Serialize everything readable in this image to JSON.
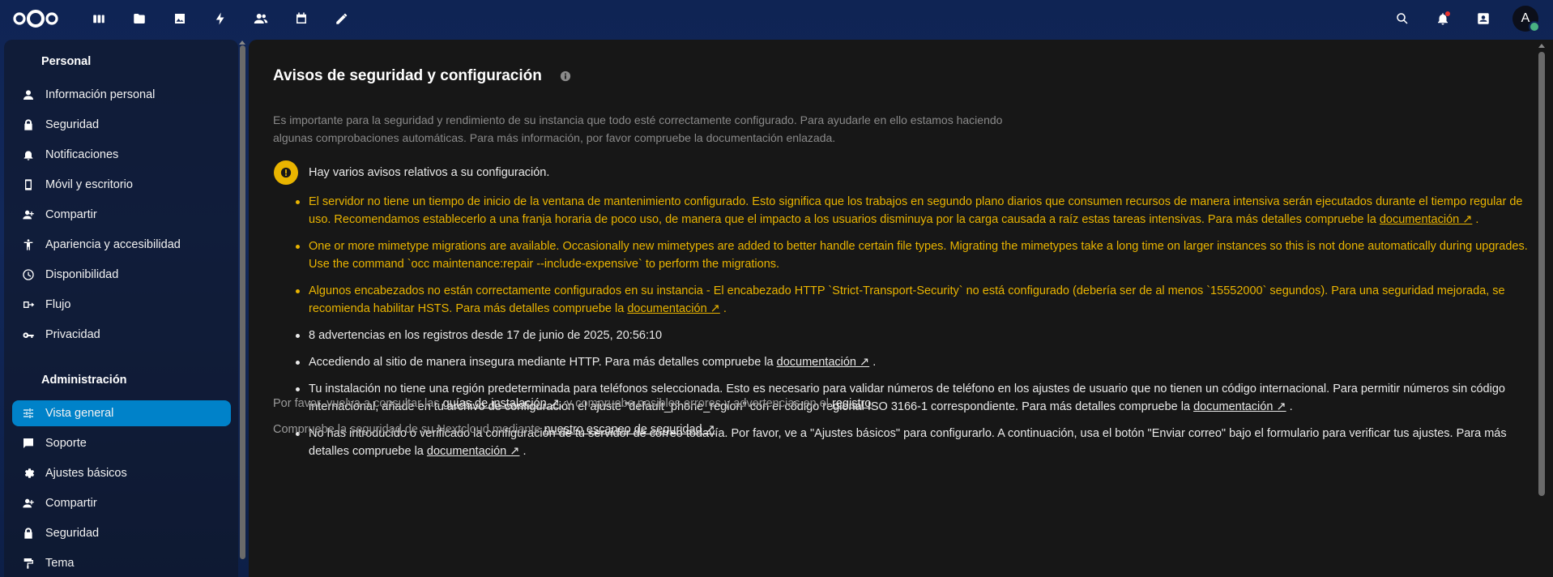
{
  "header": {
    "apps": [
      {
        "name": "dashboard-icon"
      },
      {
        "name": "files-icon"
      },
      {
        "name": "photos-icon"
      },
      {
        "name": "activity-icon"
      },
      {
        "name": "contacts-icon"
      },
      {
        "name": "calendar-icon"
      },
      {
        "name": "notes-icon"
      }
    ],
    "avatar_letter": "A"
  },
  "sidebar": {
    "personal_heading": "Personal",
    "personal_items": [
      {
        "label": "Información personal",
        "icon": "user-icon"
      },
      {
        "label": "Seguridad",
        "icon": "lock-icon"
      },
      {
        "label": "Notificaciones",
        "icon": "bell-icon"
      },
      {
        "label": "Móvil y escritorio",
        "icon": "phone-icon"
      },
      {
        "label": "Compartir",
        "icon": "share-icon"
      },
      {
        "label": "Apariencia y accesibilidad",
        "icon": "accessibility-icon"
      },
      {
        "label": "Disponibilidad",
        "icon": "clock-icon"
      },
      {
        "label": "Flujo",
        "icon": "flow-icon"
      },
      {
        "label": "Privacidad",
        "icon": "key-icon"
      }
    ],
    "admin_heading": "Administración",
    "admin_items": [
      {
        "label": "Vista general",
        "icon": "sliders-icon",
        "active": true
      },
      {
        "label": "Soporte",
        "icon": "chat-icon"
      },
      {
        "label": "Ajustes básicos",
        "icon": "gear-icon"
      },
      {
        "label": "Compartir",
        "icon": "share-icon"
      },
      {
        "label": "Seguridad",
        "icon": "lock-icon"
      },
      {
        "label": "Tema",
        "icon": "paint-icon"
      }
    ]
  },
  "main": {
    "title": "Avisos de seguridad y configuración",
    "intro": "Es importante para la seguridad y rendimiento de su instancia que todo esté correctamente configurado. Para ayudarle en ello estamos haciendo algunas comprobaciones automáticas. Para más información, por favor compruebe la documentación enlazada.",
    "warning_heading": "Hay varios avisos relativos a su configuración.",
    "link_doc": "documentación ↗",
    "issues": {
      "i1_text": "El servidor no tiene un tiempo de inicio de la ventana de mantenimiento configurado. Esto significa que los trabajos en segundo plano diarios que consumen recursos de manera intensiva serán ejecutados durante el tiempo regular de uso. Recomendamos establecerlo a una franja horaria de poco uso, de manera que el impacto a los usuarios disminuya por la carga causada a raíz estas tareas intensivas. Para más detalles compruebe la",
      "i2_text": "One or more mimetype migrations are available. Occasionally new mimetypes are added to better handle certain file types. Migrating the mimetypes take a long time on larger instances so this is not done automatically during upgrades. Use the command `occ maintenance:repair --include-expensive` to perform the migrations.",
      "i3_text": "Algunos encabezados no están correctamente configurados en su instancia - El encabezado HTTP `Strict-Transport-Security` no está configurado (debería ser de al menos `15552000` segundos). Para una seguridad mejorada, se recomienda habilitar HSTS. Para más detalles compruebe la",
      "i4_text": "8 advertencias en los registros desde 17 de junio de 2025, 20:56:10",
      "i5_text": "Accediendo al sitio de manera insegura mediante HTTP. Para más detalles compruebe la",
      "i6_text": "Tu instalación no tiene una región predeterminada para teléfonos seleccionada. Esto es necesario para validar números de teléfono en los ajustes de usuario que no tienen un código internacional. Para permitir números sin código internacional, añade en tu archivo de configuración el ajuste \"default_phone_region\" con el código regional ISO 3166-1 correspondiente. Para más detalles compruebe la",
      "i7_text": "No has introducido o verificado la configuración de tu servidor de correo todavía. Por favor, ve a \"Ajustes básicos\" para configurarlo. A continuación, usa el botón \"Enviar correo\" bajo el formulario para verificar tus ajustes. Para más detalles compruebe la"
    },
    "footer1_pre": "Por favor, vuelva a consultar las",
    "footer1_link": "guías de instalación ↗",
    "footer1_mid": ", y compruebe posibles errores y advertencias en el",
    "footer1_link2": "registro",
    "footer2_pre": "Compruebe la seguridad de su Nextcloud mediante",
    "footer2_link": "nuestro escaneo de seguridad ↗"
  },
  "colors": {
    "accent": "#0082c9",
    "warning": "#e9b400",
    "panel": "#171717"
  }
}
